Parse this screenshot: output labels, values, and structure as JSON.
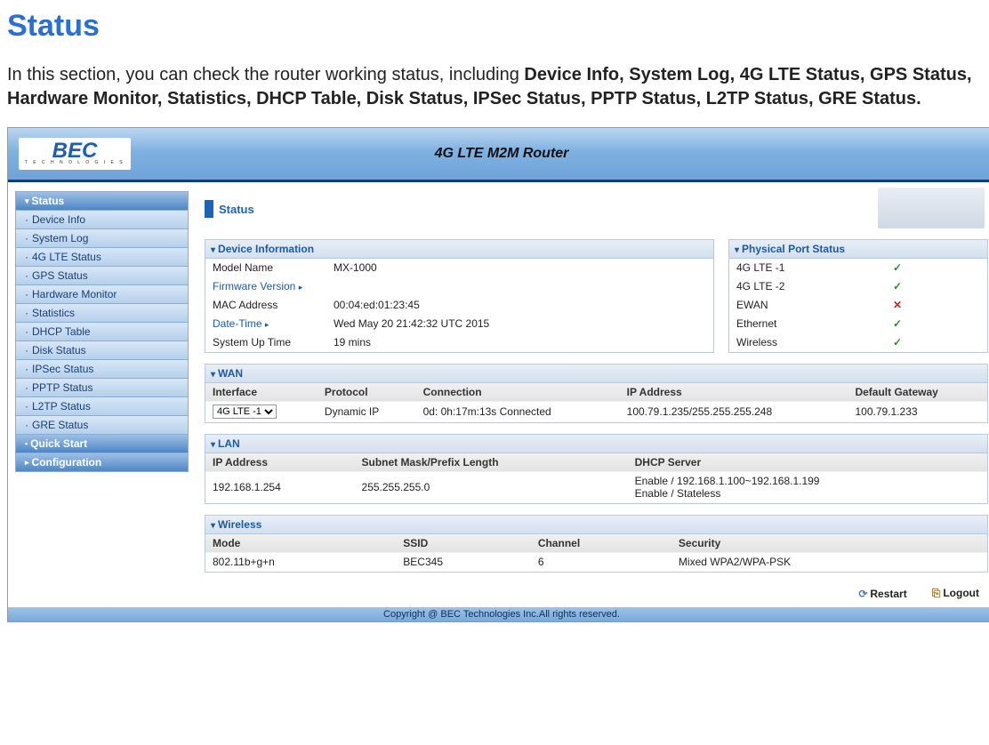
{
  "page": {
    "title": "Status",
    "intro_plain": "In this section, you can check the router working status, including ",
    "intro_bold": "Device Info, System Log, 4G LTE Status, GPS Status, Hardware Monitor, Statistics, DHCP Table, Disk Status, IPSec Status, PPTP Status, L2TP Status, GRE Status."
  },
  "banner": {
    "logo": "BEC",
    "logo_sub": "T E C H N O L O G I E S",
    "title": "4G LTE M2M Router"
  },
  "sidebar": {
    "items": [
      {
        "label": "Status",
        "type": "top"
      },
      {
        "label": "Device Info",
        "type": "sub"
      },
      {
        "label": "System Log",
        "type": "sub"
      },
      {
        "label": "4G LTE Status",
        "type": "sub"
      },
      {
        "label": "GPS Status",
        "type": "sub"
      },
      {
        "label": "Hardware Monitor",
        "type": "sub"
      },
      {
        "label": "Statistics",
        "type": "sub"
      },
      {
        "label": "DHCP Table",
        "type": "sub"
      },
      {
        "label": "Disk Status",
        "type": "sub"
      },
      {
        "label": "IPSec Status",
        "type": "sub"
      },
      {
        "label": "PPTP Status",
        "type": "sub"
      },
      {
        "label": "L2TP Status",
        "type": "sub"
      },
      {
        "label": "GRE Status",
        "type": "sub"
      },
      {
        "label": "Quick Start",
        "type": "top"
      },
      {
        "label": "Configuration",
        "type": "top"
      }
    ]
  },
  "status_header": "Status",
  "device_info": {
    "title": "Device Information",
    "rows": [
      {
        "k": "Model Name",
        "v": "MX-1000"
      },
      {
        "k": "Firmware Version",
        "v": "",
        "link": true
      },
      {
        "k": "MAC Address",
        "v": "00:04:ed:01:23:45"
      },
      {
        "k": "Date-Time",
        "v": "Wed May 20 21:42:32 UTC 2015",
        "link": true
      },
      {
        "k": "System Up Time",
        "v": "19 mins"
      }
    ]
  },
  "port_status": {
    "title": "Physical Port Status",
    "rows": [
      {
        "name": "4G LTE -1",
        "ok": true
      },
      {
        "name": "4G LTE -2",
        "ok": true
      },
      {
        "name": "EWAN",
        "ok": false
      },
      {
        "name": "Ethernet",
        "ok": true
      },
      {
        "name": "Wireless",
        "ok": true
      }
    ]
  },
  "wan": {
    "title": "WAN",
    "headers": [
      "Interface",
      "Protocol",
      "Connection",
      "IP Address",
      "Default Gateway"
    ],
    "row": {
      "interface": "4G LTE -1",
      "protocol": "Dynamic IP",
      "connection": "0d: 0h:17m:13s Connected",
      "ip": "100.79.1.235/255.255.255.248",
      "gateway": "100.79.1.233"
    }
  },
  "lan": {
    "title": "LAN",
    "headers": [
      "IP Address",
      "Subnet Mask/Prefix Length",
      "DHCP Server"
    ],
    "row": {
      "ip": "192.168.1.254",
      "mask": "255.255.255.0",
      "dhcp": "Enable / 192.168.1.100~192.168.1.199\nEnable / Stateless"
    }
  },
  "wireless": {
    "title": "Wireless",
    "headers": [
      "Mode",
      "SSID",
      "Channel",
      "Security"
    ],
    "row": {
      "mode": "802.11b+g+n",
      "ssid": "BEC345",
      "channel": "6",
      "security": "Mixed WPA2/WPA-PSK"
    }
  },
  "footer": {
    "restart": "Restart",
    "logout": "Logout",
    "copyright": "Copyright @ BEC Technologies Inc.All rights reserved."
  }
}
